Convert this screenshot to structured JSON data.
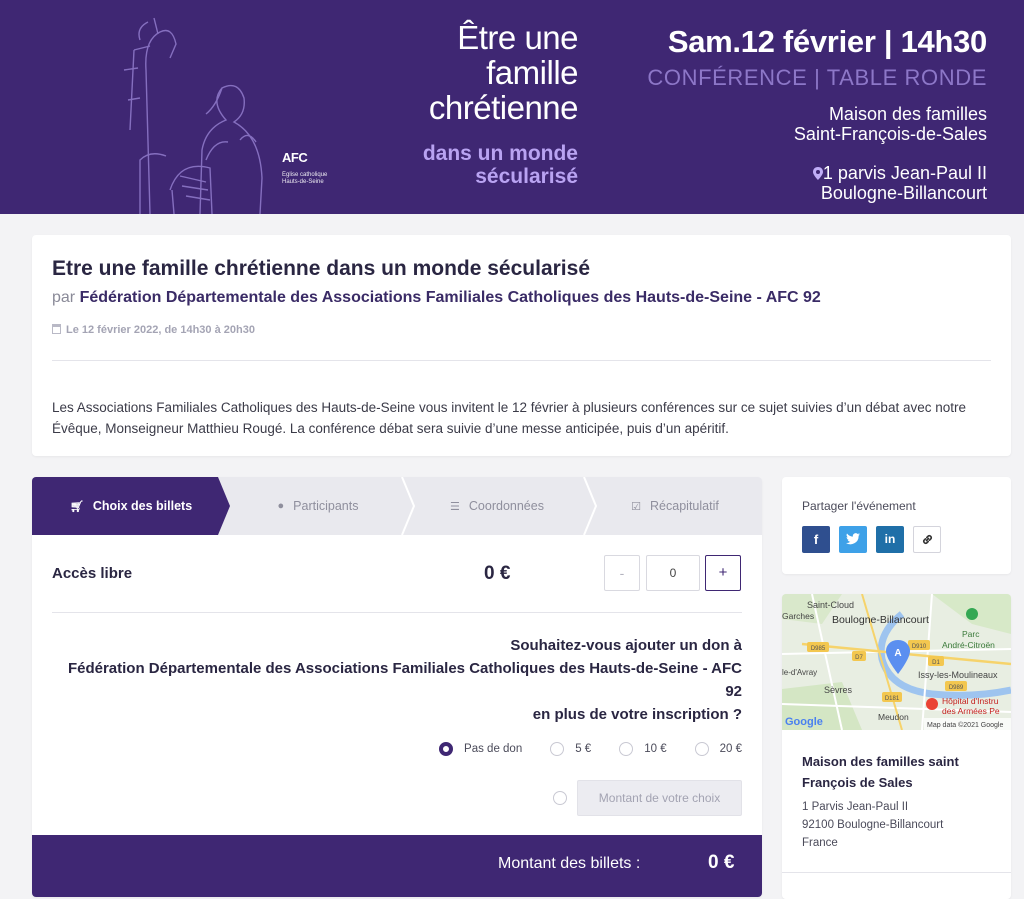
{
  "banner": {
    "title_lines": [
      "Être une",
      "famille",
      "chrétienne"
    ],
    "subtitle_lines": [
      "dans un monde",
      "sécularisé"
    ],
    "date": "Sam.12 février | 14h30",
    "type": "CONFÉRENCE | TABLE RONDE",
    "venue_lines": [
      "Maison des familles",
      "Saint-François-de-Sales"
    ],
    "address_lines": [
      "1 parvis Jean-Paul II",
      "Boulogne-Billancourt"
    ],
    "logo_text": "AFC",
    "logo_sub": "Église catholique Hauts-de-Seine"
  },
  "event": {
    "title": "Etre une famille chrétienne dans un monde sécularisé",
    "by_prefix": "par",
    "organizer": "Fédération Départementale des Associations Familiales Catholiques des Hauts-de-Seine - AFC 92",
    "date": "Le 12 février 2022, de 14h30 à 20h30",
    "description": "Les Associations Familiales Catholiques des Hauts-de-Seine vous invitent le 12 février à plusieurs conférences sur ce sujet suivies d’un débat avec notre Évêque, Monseigneur Matthieu Rougé. La conférence débat sera suivie d’une messe anticipée, puis d’un apéritif."
  },
  "steps": [
    {
      "label": "Choix des billets",
      "icon": "cart-icon"
    },
    {
      "label": "Participants",
      "icon": "user-icon"
    },
    {
      "label": "Coordonnées",
      "icon": "list-icon"
    },
    {
      "label": "Récapitulatif",
      "icon": "check-square-icon"
    }
  ],
  "ticket": {
    "name": "Accès libre",
    "price": "0 €",
    "minus": "-",
    "quantity": "0",
    "plus": "+"
  },
  "donation": {
    "question_lines": [
      "Souhaitez-vous ajouter un don à",
      "Fédération Départementale des Associations Familiales Catholiques des Hauts-de-Seine - AFC",
      "92",
      "en plus de votre inscription ?"
    ],
    "options": [
      "Pas de don",
      "5 €",
      "10 €",
      "20 €"
    ],
    "selected": "Pas de don",
    "custom_placeholder": "Montant de votre choix"
  },
  "total": {
    "label": "Montant des billets :",
    "value": "0 €"
  },
  "share": {
    "title": "Partager l'événement",
    "buttons": [
      "f",
      "t",
      "in",
      "🔗"
    ]
  },
  "map": {
    "labels": [
      "Saint-Cloud",
      "Boulogne-Billancourt",
      "Garches",
      "Parc",
      "André-Citroën",
      "Issy-les-Moulineaux",
      "Sèvres",
      "le-d'Avray",
      "Meudon",
      "Hôpital d'Instru",
      "des Armées Pe",
      "Map data ©2021 Google"
    ],
    "logo": "Google"
  },
  "venue": {
    "name_lines": [
      "Maison des familles saint",
      "François de Sales"
    ],
    "address_lines": [
      "1 Parvis Jean-Paul II",
      "92100 Boulogne-Billancourt",
      "France"
    ]
  },
  "colors": {
    "brand": "#3f2773",
    "accent": "#b9a3f2"
  }
}
